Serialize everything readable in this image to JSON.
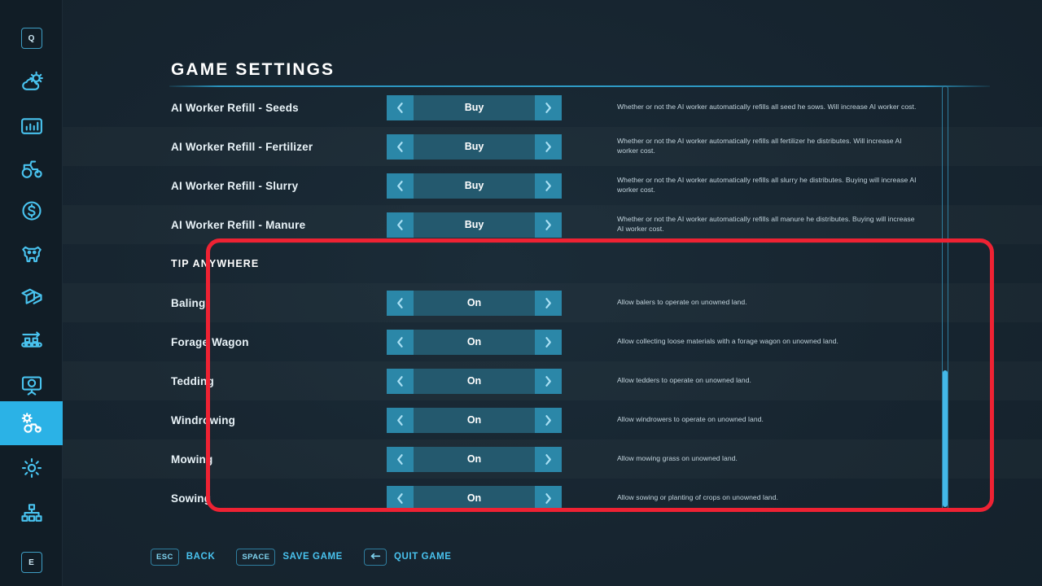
{
  "sidebar": {
    "items": [
      {
        "icon": "keycap-q-icon",
        "name": "sidebar-item-help",
        "label": "Q",
        "active": false
      },
      {
        "icon": "weather-icon",
        "name": "sidebar-item-weather",
        "label": "",
        "active": false
      },
      {
        "icon": "statistics-icon",
        "name": "sidebar-item-statistics",
        "label": "",
        "active": false
      },
      {
        "icon": "tractor-icon",
        "name": "sidebar-item-vehicles",
        "label": "",
        "active": false
      },
      {
        "icon": "finances-icon",
        "name": "sidebar-item-finances",
        "label": "",
        "active": false
      },
      {
        "icon": "animals-icon",
        "name": "sidebar-item-animals",
        "label": "",
        "active": false
      },
      {
        "icon": "documents-icon",
        "name": "sidebar-item-contracts",
        "label": "",
        "active": false
      },
      {
        "icon": "production-icon",
        "name": "sidebar-item-production",
        "label": "",
        "active": false
      },
      {
        "icon": "presentation-icon",
        "name": "sidebar-item-map-overview",
        "label": "",
        "active": false
      },
      {
        "icon": "game-settings-icon",
        "name": "sidebar-item-game-settings",
        "label": "",
        "active": true
      },
      {
        "icon": "gear-icon",
        "name": "sidebar-item-general-settings",
        "label": "",
        "active": false
      },
      {
        "icon": "multiplayer-icon",
        "name": "sidebar-item-multiplayer",
        "label": "",
        "active": false
      },
      {
        "icon": "keycap-e-icon",
        "name": "sidebar-item-next-page",
        "label": "E",
        "active": false
      }
    ]
  },
  "header": {
    "title": "GAME SETTINGS"
  },
  "settings": {
    "rows": [
      {
        "type": "setting",
        "label": "AI Worker Refill - Seeds",
        "value": "Buy",
        "description": "Whether or not the AI worker automatically refills all seed he sows. Will increase AI worker cost."
      },
      {
        "type": "setting",
        "label": "AI Worker Refill - Fertilizer",
        "value": "Buy",
        "description": "Whether or not the AI worker automatically refills all fertilizer he distributes. Will increase AI worker cost."
      },
      {
        "type": "setting",
        "label": "AI Worker Refill - Slurry",
        "value": "Buy",
        "description": "Whether or not the AI worker automatically refills all slurry he distributes. Buying will increase AI worker cost."
      },
      {
        "type": "setting",
        "label": "AI Worker Refill - Manure",
        "value": "Buy",
        "description": "Whether or not the AI worker automatically refills all manure he distributes. Buying will increase AI worker cost."
      },
      {
        "type": "section",
        "label": "TIP ANYWHERE",
        "value": "",
        "description": ""
      },
      {
        "type": "setting",
        "label": "Baling",
        "value": "On",
        "description": "Allow balers to operate on unowned land."
      },
      {
        "type": "setting",
        "label": "Forage Wagon",
        "value": "On",
        "description": "Allow collecting loose materials with a forage wagon on unowned land."
      },
      {
        "type": "setting",
        "label": "Tedding",
        "value": "On",
        "description": "Allow tedders to operate on unowned land."
      },
      {
        "type": "setting",
        "label": "Windrowing",
        "value": "On",
        "description": "Allow windrowers to operate on unowned land."
      },
      {
        "type": "setting",
        "label": "Mowing",
        "value": "On",
        "description": "Allow mowing grass on unowned land."
      },
      {
        "type": "setting",
        "label": "Sowing",
        "value": "On",
        "description": "Allow sowing or planting of crops on unowned land."
      }
    ]
  },
  "footer": {
    "hints": [
      {
        "key": "ESC",
        "key_icon": "",
        "label": "BACK"
      },
      {
        "key": "SPACE",
        "key_icon": "",
        "label": "SAVE GAME"
      },
      {
        "key": "",
        "key_icon": "arrow-left-icon",
        "label": "QUIT GAME"
      }
    ]
  },
  "colors": {
    "background": "#16242e",
    "accent": "#2bb2e6",
    "selector_arrow": "#2b87a8",
    "selector_mid": "#24596e",
    "annotation": "#ee2233",
    "sidebar": "#111d26"
  }
}
